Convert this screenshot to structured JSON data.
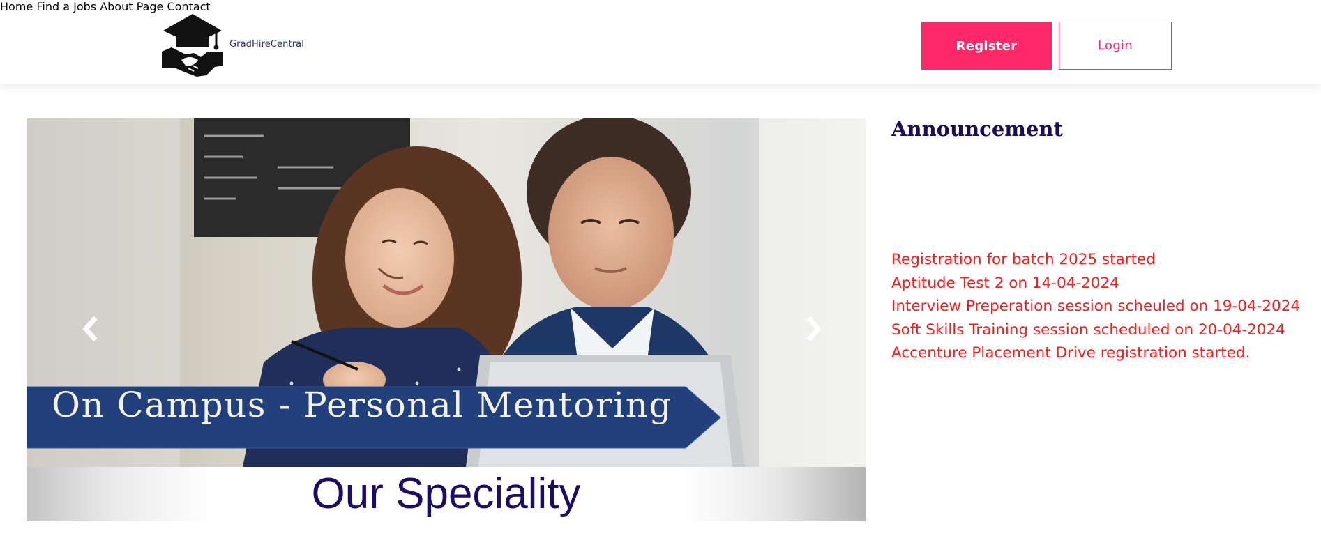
{
  "brand": {
    "name": "GradHireCentral",
    "logo_icon": "graduation-cap-handshake-icon"
  },
  "nav": {
    "items": [
      "Home",
      "Find a Jobs",
      "About",
      "Page",
      "Contact"
    ]
  },
  "auth": {
    "register_label": "Register",
    "login_label": "Login"
  },
  "carousel": {
    "banner_text": "On Campus - Personal Mentoring",
    "caption": "Our Speciality",
    "prev_icon": "chevron-left-icon",
    "next_icon": "chevron-right-icon"
  },
  "announcement": {
    "title": "Announcement",
    "items": [
      "Registration for batch 2025 started",
      "Aptitude Test 2 on 14-04-2024",
      "Interview Preperation session scheuled on 19-04-2024",
      "Soft Skills Training session scheduled on 20-04-2024",
      "Accenture Placement Drive registration started."
    ]
  },
  "colors": {
    "accent": "#ff2869",
    "nav_text": "#232a55",
    "announcement_title": "#1b0b5c",
    "announcement_text": "#ff1a1a",
    "banner": "#21407c",
    "caption": "#1a0d69"
  }
}
